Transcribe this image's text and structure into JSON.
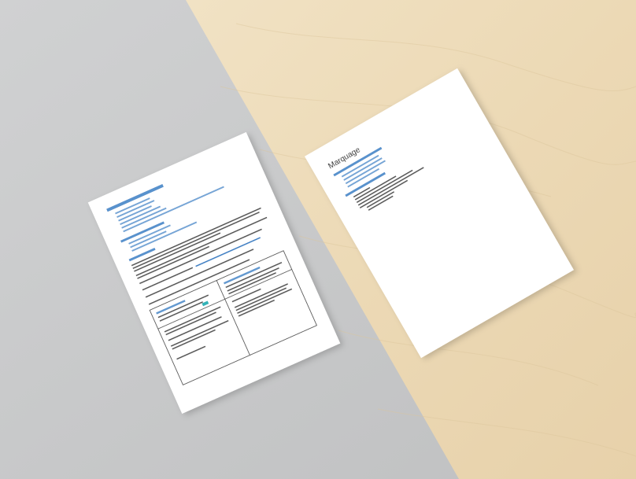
{
  "colors": {
    "concrete": "#c9cacb",
    "wood": "#eedcba",
    "paper": "#ffffff",
    "link": "#3b7fc4",
    "heading": "#222222"
  },
  "right_document": {
    "title": "Marquage"
  },
  "left_document": {
    "title": "",
    "links": []
  }
}
